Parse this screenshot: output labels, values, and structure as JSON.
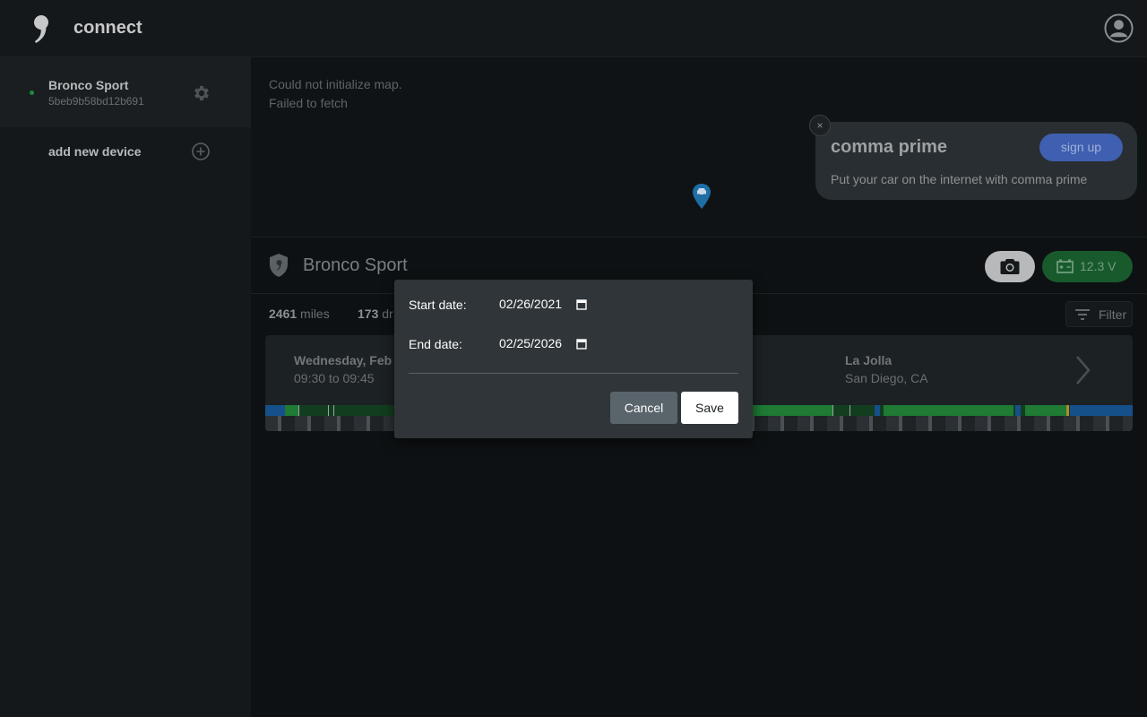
{
  "header": {
    "app_title": "connect",
    "logo_icon": "comma-logo-icon",
    "avatar_icon": "user-avatar-icon"
  },
  "sidebar": {
    "devices": [
      {
        "name": "Bronco Sport",
        "id": "5beb9b58bd12b691",
        "status": "online"
      }
    ],
    "add_device_label": "add new device",
    "icons": {
      "settings": "gear-icon",
      "add": "plus-circle-icon"
    }
  },
  "map": {
    "error_lines": [
      "Could not initialize map.",
      "Failed to fetch"
    ]
  },
  "prime_banner": {
    "title": "comma prime",
    "text": "Put your car on the internet with comma prime",
    "signup_label": "sign up",
    "close_label": "×"
  },
  "vehicle": {
    "name": "Bronco Sport",
    "battery": "12.3 V"
  },
  "stats": {
    "miles_value": "2461",
    "miles_unit": "miles",
    "drives_value": "173",
    "drives_unit": "dr"
  },
  "filter": {
    "label": "Filter"
  },
  "drive": {
    "date": "Wednesday, Feb",
    "time": "09:30 to 09:45",
    "destination": "La Jolla",
    "city": "San Diego, CA"
  },
  "date_modal": {
    "start_label": "Start date:",
    "start_value": "02/26/2021",
    "end_label": "End date:",
    "end_value": "02/25/2026",
    "cancel_label": "Cancel",
    "save_label": "Save"
  },
  "colors": {
    "accent_blue": "#3f5fb0",
    "battery_green": "#185a2c",
    "online_green": "#1f8b3c"
  }
}
